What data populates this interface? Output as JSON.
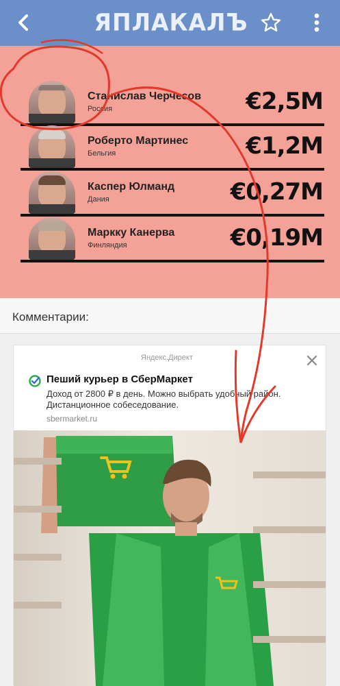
{
  "header": {
    "logo_text": "ЯПЛАКАЛЪ",
    "back_icon": "chevron-left-icon",
    "favorite_icon": "star-icon",
    "menu_icon": "more-vertical-icon"
  },
  "salaries": [
    {
      "name": "Станислав Черчесов",
      "country": "Россия",
      "amount": "€2,5M"
    },
    {
      "name": "Роберто Мартинес",
      "country": "Бельгия",
      "amount": "€1,2M"
    },
    {
      "name": "Каспер Юлманд",
      "country": "Дания",
      "amount": "€0,27M"
    },
    {
      "name": "Маркку Канерва",
      "country": "Финляндия",
      "amount": "€0,19M"
    }
  ],
  "comments": {
    "title": "Комментарии:"
  },
  "ad": {
    "source": "Яндекс.Директ",
    "title": "Пеший курьер в СберМаркет",
    "description": "Доход от 2800 ₽ в день. Можно выбрать удобный район. Дистанционное собеседование.",
    "domain": "sbermarket.ru"
  },
  "colors": {
    "header": "#6b8fc9",
    "card": "#f4a197",
    "brand_green": "#2fa84f",
    "annotation_red": "#e23a2a"
  }
}
